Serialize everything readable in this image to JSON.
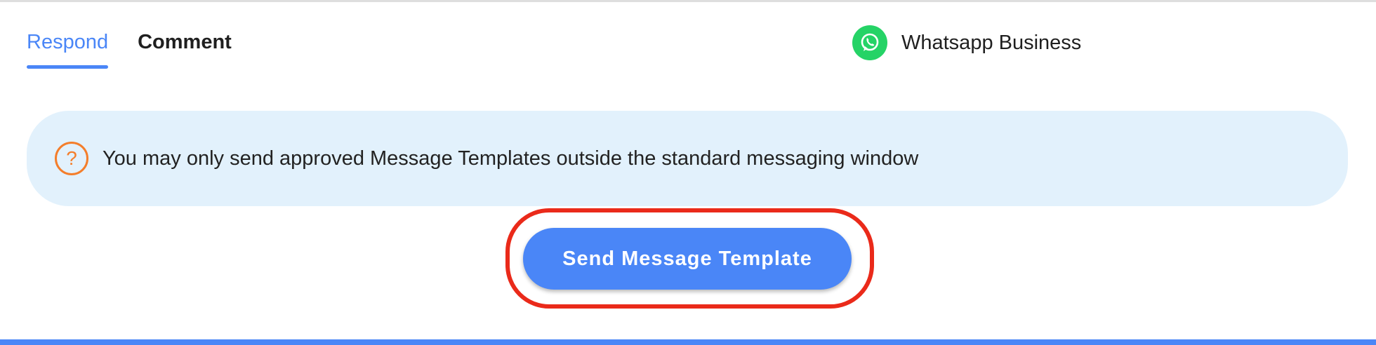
{
  "tabs": [
    {
      "label": "Respond",
      "active": true
    },
    {
      "label": "Comment",
      "active": false
    }
  ],
  "channel": {
    "label": "Whatsapp Business",
    "icon": "whatsapp-icon",
    "icon_color": "#25d366"
  },
  "notice": {
    "icon": "question-circle-icon",
    "icon_glyph": "?",
    "icon_color": "#f47e2b",
    "text": "You may only send approved Message Templates outside the standard messaging window",
    "background": "#e2f1fc"
  },
  "action": {
    "send_template_label": "Send Message Template",
    "button_color": "#4a86f7",
    "highlight_color": "#ea2a1a"
  },
  "colors": {
    "accent": "#4a86f7"
  }
}
